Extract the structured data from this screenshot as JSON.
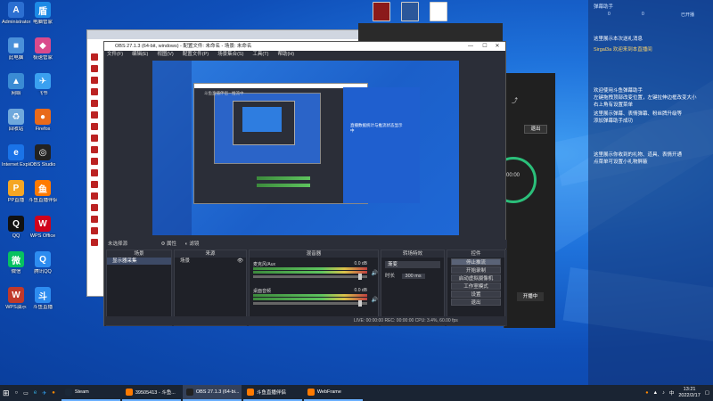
{
  "desktop_icons_left": [
    {
      "label": "Administrator",
      "color": "#2c6fd1",
      "glyph": "A"
    },
    {
      "label": "电脑管家",
      "color": "#1d8be6",
      "glyph": "盾"
    },
    {
      "label": "此电脑",
      "color": "#4a90d9",
      "glyph": "■"
    },
    {
      "label": "极速管家",
      "color": "#d94a8c",
      "glyph": "◆"
    },
    {
      "label": "网络",
      "color": "#3a8bd4",
      "glyph": "▲"
    },
    {
      "label": "飞书",
      "color": "#3aa0f0",
      "glyph": "✈"
    },
    {
      "label": "回收站",
      "color": "#6fa8dc",
      "glyph": "♻"
    },
    {
      "label": "Firefox",
      "color": "#e86a1a",
      "glyph": "●"
    },
    {
      "label": "Internet Explorer",
      "color": "#1a73e8",
      "glyph": "e"
    },
    {
      "label": "OBS Studio",
      "color": "#222222",
      "glyph": "◎"
    },
    {
      "label": "PP直播",
      "color": "#f5a623",
      "glyph": "P"
    },
    {
      "label": "斗鱼直播伴侣",
      "color": "#ff7a00",
      "glyph": "鱼"
    },
    {
      "label": "QQ",
      "color": "#111111",
      "glyph": "Q"
    },
    {
      "label": "WPS Office",
      "color": "#d0021b",
      "glyph": "W"
    },
    {
      "label": "微信",
      "color": "#07c160",
      "glyph": "微"
    },
    {
      "label": "腾讯QQ",
      "color": "#2d8cf0",
      "glyph": "Q"
    },
    {
      "label": "WPS演示",
      "color": "#c0392b",
      "glyph": "W"
    },
    {
      "label": "斗鱼直播",
      "color": "#2d8cf0",
      "glyph": "斗"
    }
  ],
  "top_icons": [
    {
      "label": "WinRAR",
      "color": "#8b1a1a"
    },
    {
      "label": "Word",
      "color": "#2b579a"
    },
    {
      "label": "文档",
      "color": "#ffffff"
    }
  ],
  "right_panel": {
    "title": "弹幕助手",
    "stats": [
      "0",
      "0",
      "已开播"
    ],
    "messages": [
      {
        "text": "这里展示本次送礼消息",
        "hl": false
      },
      {
        "text": "Sirgal3a 欢迎来到本直播间",
        "hl": true
      },
      {
        "text": "欢迎使用斗鱼弹幕助手",
        "hl": false
      },
      {
        "text": "左键拖拽顶部改变位置，左键拉伸边框改变大小",
        "hl": false
      },
      {
        "text": "右上角有设置菜单",
        "hl": false
      },
      {
        "text": "这里展示弹幕、表情弹幕、粉丝牌升级等",
        "hl": false
      },
      {
        "text": "添加弹幕助手成功",
        "hl": false
      },
      {
        "text": "这里展示你收到的礼物、道具、表情开通",
        "hl": false
      },
      {
        "text": "点菜单可设置小礼物屏蔽",
        "hl": false
      }
    ]
  },
  "obs": {
    "title": "OBS 27.1.3 (64-bit, windows) - 配置文件: 未命名 - 场景: 未命名",
    "menu": [
      "文件(F)",
      "编辑(E)",
      "视图(V)",
      "配置文件(P)",
      "场景集合(S)",
      "工具(T)",
      "帮助(H)"
    ],
    "scene_bar": "未选择源",
    "scene_bar_buttons": [
      "属性",
      "滤镜"
    ],
    "docks": {
      "scenes": {
        "title": "场景",
        "items": [
          "显示器采集"
        ]
      },
      "sources": {
        "title": "来源",
        "items": [
          "场景"
        ]
      },
      "mixer": {
        "title": "混音器",
        "channels": [
          {
            "name": "麦克风/Aux",
            "db": "0.0 dB"
          },
          {
            "name": "桌面音频",
            "db": "0.0 dB"
          }
        ]
      },
      "transitions": {
        "title": "转场特效",
        "type": "渐变",
        "duration_label": "时长",
        "duration": "300 ms"
      },
      "controls": {
        "title": "控件",
        "buttons": [
          "停止推流",
          "开始录制",
          "启动虚拟摄像机",
          "工作室模式",
          "设置",
          "退出"
        ]
      }
    },
    "status": "LIVE: 00:00:00   REC: 00:00:00   CPU: 3.4%, 60.00 fps"
  },
  "preview_text": {
    "inner_title": "斗鱼直播伴侣 - 推流中",
    "side_text": "直播数据统计与推流状态显示中"
  },
  "right_app": {
    "timer": "00:00",
    "btn_exit": "退出",
    "stat1": "0",
    "stat2": "开播中"
  },
  "taskbar": {
    "apps": [
      {
        "label": "Steam",
        "color": "#1b2838",
        "active": false
      },
      {
        "label": "3950541​3 - 斗鱼...",
        "color": "#ff7a00",
        "active": false
      },
      {
        "label": "OBS 27.1.3 (64-bi...",
        "color": "#222222",
        "active": true
      },
      {
        "label": "斗鱼直播伴侣",
        "color": "#ff7a00",
        "active": false
      },
      {
        "label": "WebFrame",
        "color": "#ff7a00",
        "active": false
      }
    ],
    "time": "13:21",
    "date": "2022/2/17",
    "lang": "中"
  }
}
